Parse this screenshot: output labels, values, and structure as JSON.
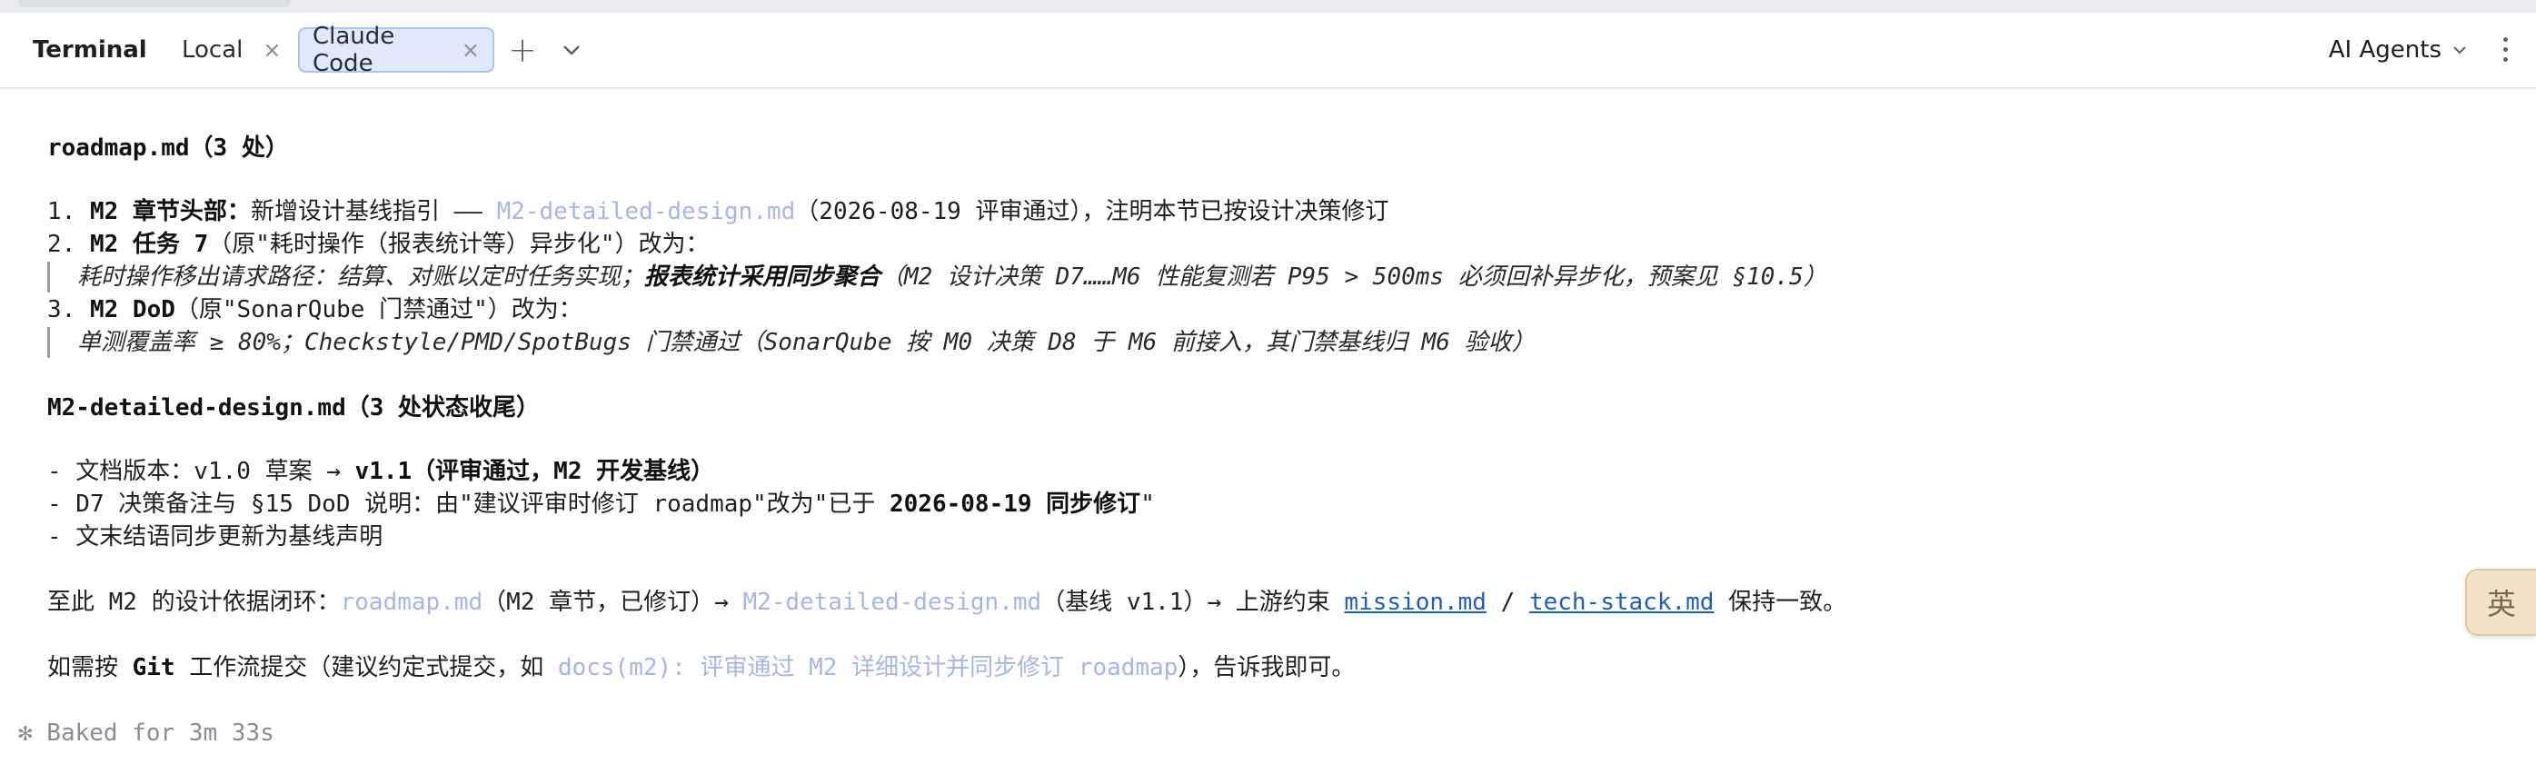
{
  "tabbar": {
    "tool_title": "Terminal",
    "tabs": [
      {
        "label": "Local",
        "close": "×"
      },
      {
        "label": "Claude Code",
        "close": "×"
      }
    ],
    "plus": "+",
    "agents_label": "AI Agents"
  },
  "terminal": {
    "roadmap_heading": "roadmap.md（3 处）",
    "item1": {
      "num": "1. ",
      "title": "M2 章节头部：",
      "pre": "新增设计基线指引 —— ",
      "link": "M2-detailed-design.md",
      "post": "（2026-08-19 评审通过），注明本节已按设计决策修订"
    },
    "item2": {
      "num": "2. ",
      "title": "M2 任务 7",
      "rest": "（原\"耗时操作（报表统计等）异步化\"）改为："
    },
    "quote1": {
      "pre": "耗时操作移出请求路径：结算、对账以定时任务实现；",
      "bold": "报表统计采用同步聚合",
      "post": "（M2 设计决策 D7……M6 性能复测若 P95 > 500ms 必须回补异步化，预案见 §10.5）"
    },
    "item3": {
      "num": "3. ",
      "title": "M2 DoD",
      "rest": "（原\"SonarQube 门禁通过\"）改为："
    },
    "quote2": "单测覆盖率 ≥ 80%；Checkstyle/PMD/SpotBugs 门禁通过（SonarQube 按 M0 决策 D8 于 M6 前接入，其门禁基线归 M6 验收）",
    "design_heading": "M2-detailed-design.md（3 处状态收尾）",
    "bullet1": {
      "pre": "- 文档版本：v1.0 草案 → ",
      "bold": "v1.1（评审通过，M2 开发基线）"
    },
    "bullet2": {
      "pre": "- D7 决策备注与 §15 DoD 说明：由\"建议评审时修订 roadmap\"改为\"已于 ",
      "bold": "2026-08-19 同步修订",
      "post": "\""
    },
    "bullet3": "- 文末结语同步更新为基线声明",
    "summary": {
      "pre": "至此 M2 的设计依据闭环：",
      "link1": "roadmap.md",
      "mid1": "（M2 章节，已修订）→ ",
      "link2": "M2-detailed-design.md",
      "mid2": "（基线 v1.1）→ 上游约束 ",
      "link3": "mission.md",
      "sep": " / ",
      "link4": "tech-stack.md",
      "post": " 保持一致。"
    },
    "commit": {
      "pre": "如需按 ",
      "bold": "Git",
      "mid": " 工作流提交（建议约定式提交，如 ",
      "msg": "docs(m2): 评审通过 M2 详细设计并同步修订 roadmap",
      "post": "），告诉我即可。"
    },
    "status": "✻ Baked for 3m 33s"
  },
  "ime_label": "英"
}
